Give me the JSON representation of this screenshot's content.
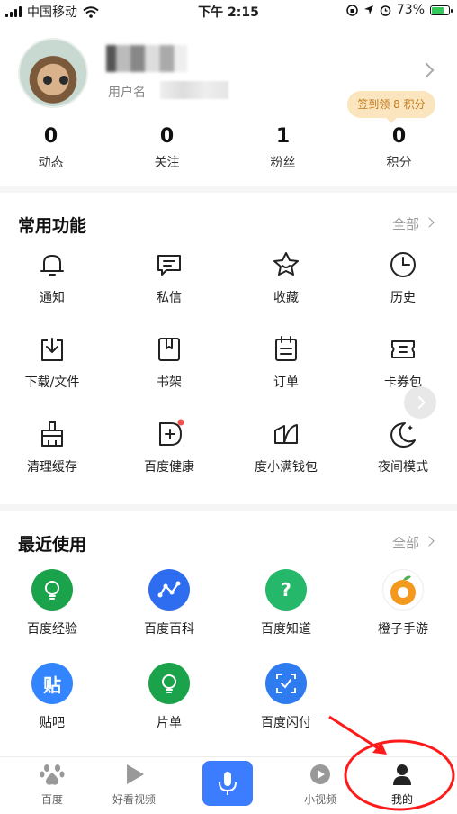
{
  "status_bar": {
    "carrier": "中国移动",
    "time": "下午 2:15",
    "battery": "73%",
    "battery_level": 0.73
  },
  "profile": {
    "username_label": "用户名",
    "signin_badge": "签到领 8 积分",
    "stats": [
      {
        "value": "0",
        "label": "动态"
      },
      {
        "value": "0",
        "label": "关注"
      },
      {
        "value": "1",
        "label": "粉丝"
      },
      {
        "value": "0",
        "label": "积分"
      }
    ]
  },
  "common": {
    "title": "常用功能",
    "more": "全部",
    "items": [
      {
        "label": "通知",
        "icon": "bell-icon"
      },
      {
        "label": "私信",
        "icon": "message-icon"
      },
      {
        "label": "收藏",
        "icon": "star-icon"
      },
      {
        "label": "历史",
        "icon": "clock-icon"
      },
      {
        "label": "下载/文件",
        "icon": "download-icon"
      },
      {
        "label": "书架",
        "icon": "bookshelf-icon"
      },
      {
        "label": "订单",
        "icon": "order-icon"
      },
      {
        "label": "卡券包",
        "icon": "coupon-icon"
      },
      {
        "label": "清理缓存",
        "icon": "clean-icon"
      },
      {
        "label": "百度健康",
        "icon": "health-icon"
      },
      {
        "label": "度小满钱包",
        "icon": "wallet-icon"
      },
      {
        "label": "夜间模式",
        "icon": "moon-icon"
      }
    ]
  },
  "recent": {
    "title": "最近使用",
    "more": "全部",
    "items": [
      {
        "label": "百度经验",
        "icon": "bulb-icon",
        "color": "#1aa34a"
      },
      {
        "label": "百度百科",
        "icon": "baike-icon",
        "color": "#2f6df0"
      },
      {
        "label": "百度知道",
        "icon": "question-icon",
        "color": "#25b86a"
      },
      {
        "label": "橙子手游",
        "icon": "orange-icon",
        "color": "#f39a1e"
      },
      {
        "label": "贴吧",
        "icon": "tieba-icon",
        "color": "#3385ff",
        "glyph": "贴"
      },
      {
        "label": "片单",
        "icon": "bulb-icon",
        "color": "#1aa34a"
      },
      {
        "label": "百度闪付",
        "icon": "scan-pay-icon",
        "color": "#2f7bf0"
      }
    ]
  },
  "tabbar": {
    "items": [
      {
        "label": "百度",
        "icon": "baidu-paw-icon"
      },
      {
        "label": "好看视频",
        "icon": "play-icon"
      },
      {
        "label": "",
        "icon": "mic-icon"
      },
      {
        "label": "小视频",
        "icon": "small-video-icon"
      },
      {
        "label": "我的",
        "icon": "user-icon"
      }
    ]
  },
  "colors": {
    "accent": "#3c7cff",
    "annotation": "#ff1a1a",
    "badge_bg": "#fbe5bf",
    "badge_text": "#c07a1e"
  }
}
